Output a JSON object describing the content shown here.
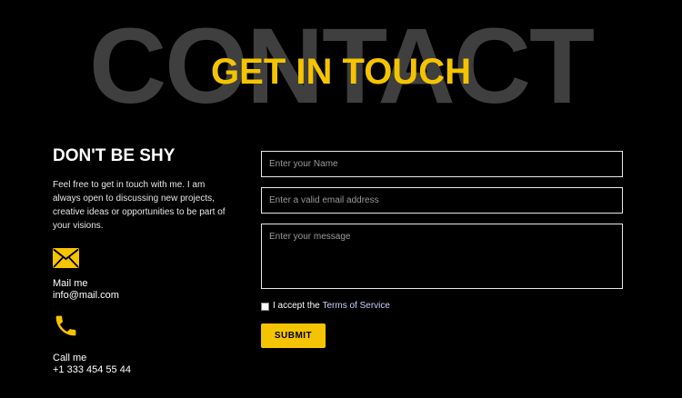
{
  "hero": {
    "background_word": "CONTACT",
    "headline": "GET IN TOUCH"
  },
  "intro": {
    "heading": "DON'T BE SHY",
    "text": "Feel free to get in touch with me. I am always open to discussing new projects, creative ideas or opportunities to be part of your visions."
  },
  "contacts": {
    "mail": {
      "icon": "envelope-icon",
      "label": "Mail me",
      "value": "info@mail.com"
    },
    "phone": {
      "icon": "phone-icon",
      "label": "Call me",
      "value": "+1 333 454 55 44"
    }
  },
  "form": {
    "name_placeholder": "Enter your Name",
    "email_placeholder": "Enter a valid email address",
    "message_placeholder": "Enter your message",
    "terms_prefix": "I accept the ",
    "terms_link": "Terms of Service",
    "submit_label": "SUBMIT"
  },
  "colors": {
    "accent": "#f5c400",
    "background": "#000000",
    "background_word": "#3f3f3f",
    "link": "#c9d1ff"
  }
}
